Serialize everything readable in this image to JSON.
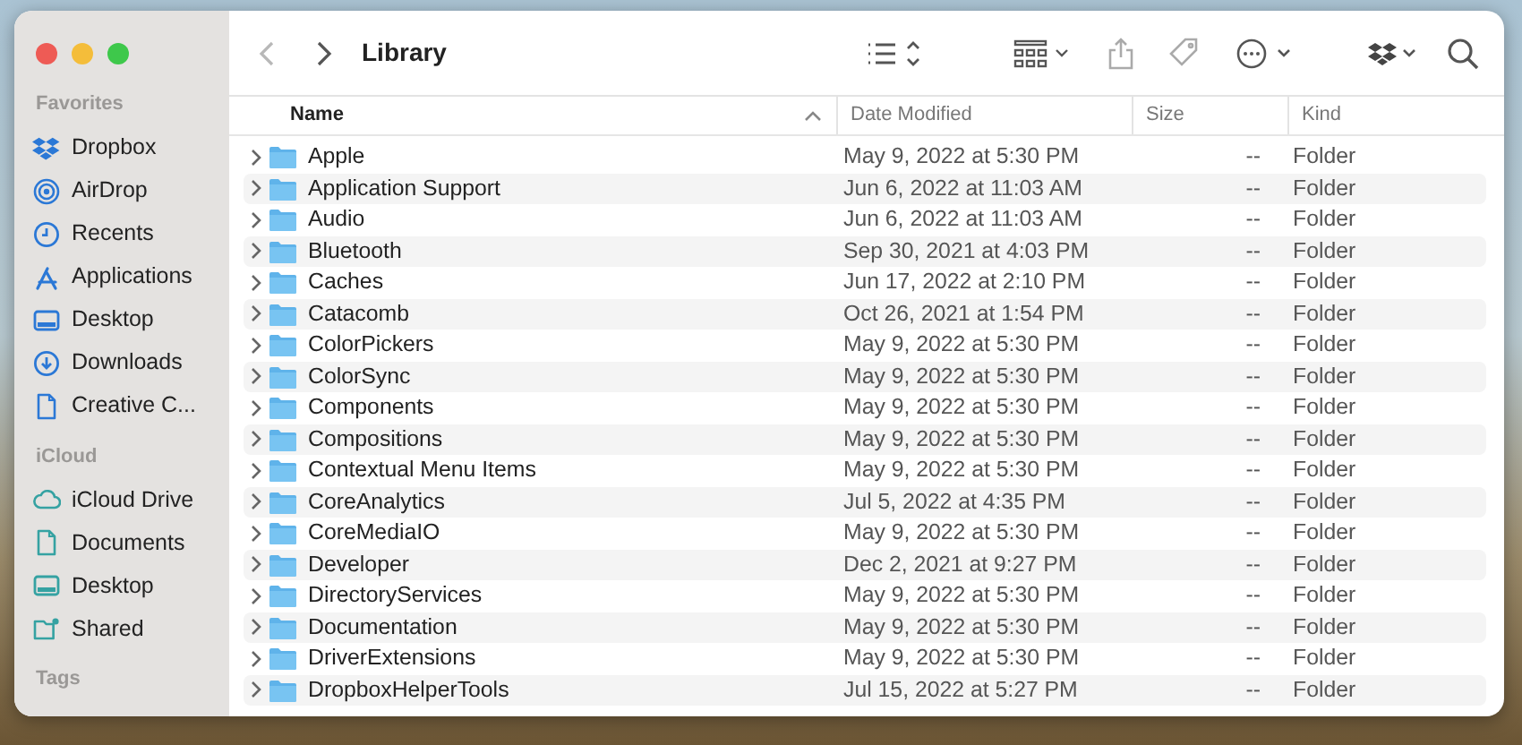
{
  "window": {
    "title": "Library"
  },
  "sidebar": {
    "sections": [
      {
        "title": "Favorites",
        "items": [
          {
            "label": "Dropbox"
          },
          {
            "label": "AirDrop"
          },
          {
            "label": "Recents"
          },
          {
            "label": "Applications"
          },
          {
            "label": "Desktop"
          },
          {
            "label": "Downloads"
          },
          {
            "label": "Creative C..."
          }
        ]
      },
      {
        "title": "iCloud",
        "items": [
          {
            "label": "iCloud Drive"
          },
          {
            "label": "Documents"
          },
          {
            "label": "Desktop"
          },
          {
            "label": "Shared"
          }
        ]
      },
      {
        "title": "Tags"
      }
    ]
  },
  "table": {
    "columns": [
      {
        "label": "Name",
        "sorted": true
      },
      {
        "label": "Date Modified",
        "sorted": false
      },
      {
        "label": "Size",
        "sorted": false
      },
      {
        "label": "Kind",
        "sorted": false
      }
    ],
    "rows": [
      {
        "name": "Apple",
        "date": "May 9, 2022 at 5:30 PM",
        "size": "--",
        "kind": "Folder"
      },
      {
        "name": "Application Support",
        "date": "Jun 6, 2022 at 11:03 AM",
        "size": "--",
        "kind": "Folder"
      },
      {
        "name": "Audio",
        "date": "Jun 6, 2022 at 11:03 AM",
        "size": "--",
        "kind": "Folder"
      },
      {
        "name": "Bluetooth",
        "date": "Sep 30, 2021 at 4:03 PM",
        "size": "--",
        "kind": "Folder"
      },
      {
        "name": "Caches",
        "date": "Jun 17, 2022 at 2:10 PM",
        "size": "--",
        "kind": "Folder"
      },
      {
        "name": "Catacomb",
        "date": "Oct 26, 2021 at 1:54 PM",
        "size": "--",
        "kind": "Folder"
      },
      {
        "name": "ColorPickers",
        "date": "May 9, 2022 at 5:30 PM",
        "size": "--",
        "kind": "Folder"
      },
      {
        "name": "ColorSync",
        "date": "May 9, 2022 at 5:30 PM",
        "size": "--",
        "kind": "Folder"
      },
      {
        "name": "Components",
        "date": "May 9, 2022 at 5:30 PM",
        "size": "--",
        "kind": "Folder"
      },
      {
        "name": "Compositions",
        "date": "May 9, 2022 at 5:30 PM",
        "size": "--",
        "kind": "Folder"
      },
      {
        "name": "Contextual Menu Items",
        "date": "May 9, 2022 at 5:30 PM",
        "size": "--",
        "kind": "Folder"
      },
      {
        "name": "CoreAnalytics",
        "date": "Jul 5, 2022 at 4:35 PM",
        "size": "--",
        "kind": "Folder"
      },
      {
        "name": "CoreMediaIO",
        "date": "May 9, 2022 at 5:30 PM",
        "size": "--",
        "kind": "Folder"
      },
      {
        "name": "Developer",
        "date": "Dec 2, 2021 at 9:27 PM",
        "size": "--",
        "kind": "Folder"
      },
      {
        "name": "DirectoryServices",
        "date": "May 9, 2022 at 5:30 PM",
        "size": "--",
        "kind": "Folder"
      },
      {
        "name": "Documentation",
        "date": "May 9, 2022 at 5:30 PM",
        "size": "--",
        "kind": "Folder"
      },
      {
        "name": "DriverExtensions",
        "date": "May 9, 2022 at 5:30 PM",
        "size": "--",
        "kind": "Folder"
      },
      {
        "name": "DropboxHelperTools",
        "date": "Jul 15, 2022 at 5:27 PM",
        "size": "--",
        "kind": "Folder"
      }
    ]
  }
}
